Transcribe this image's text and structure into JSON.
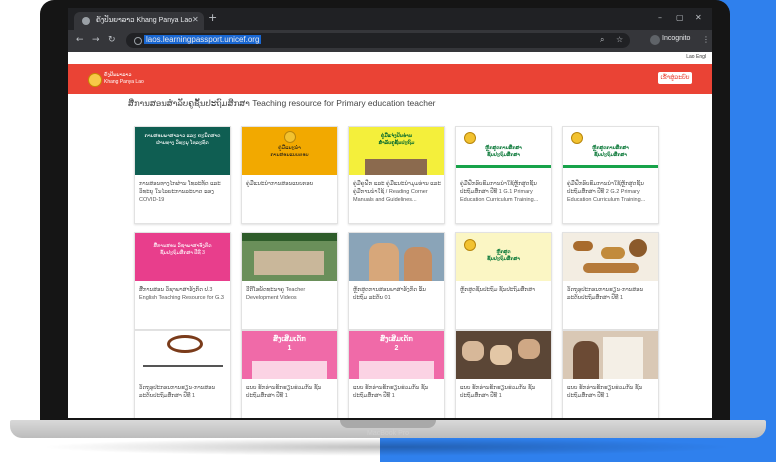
{
  "browser": {
    "tab_title": "ຄັງປັນຍາລາວ Khang Panya Lao",
    "new_tab": "+",
    "url": "laos.learningpassport.unicef.org",
    "profile": "Incognito",
    "win_min": "–",
    "win_max": "▢",
    "win_close": "✕",
    "back": "←",
    "forward": "→",
    "reload": "↻",
    "search_glyph": "⌕",
    "star_glyph": "☆",
    "menu_glyph": "⋮",
    "tab_close": "✕"
  },
  "site": {
    "lang_switch": "Lao  Engl",
    "logo_text": "ຄັງປັນຍາລາວ\nKhang Panya Lao",
    "login_label": "ເຂົ້າສູ່ລະບົບ",
    "page_title": "ສື່ການສອນສຳລັບຄູຊັ້ນປະຖົມສຶກສາ Teaching resource for Primary education teacher"
  },
  "cards": [
    {
      "thumb_text": "ການສອນພາສາລາວ ແລະ ຄະນິດສາດ\nຜ່ານທາງ ວິທະຍຸ ໂທລະທັດ",
      "caption": "ການສອນທາງໄກຜ່ານ ໂທລະທັດ ແລະ ວິທະຍຸ ໃນໄລຍະການລະບາດ ຂອງ COVID-19"
    },
    {
      "thumb_text": "ຄູ່ມືແນະນຳ\nການສອນແບບຕອບ",
      "caption": "ຄູ່ມືແນະນຳການສອນແບບຕອບ"
    },
    {
      "thumb_text": "ຄູ່ມືແຈ່ງປັນອ່ານ\nສຳລັບຄູຊັ້ນປະຖົມ",
      "caption": "ຄູ່ມືຄູຝຶກ ແລະ ຄູ່ມືແນະນຳມຸມອ່ານ ແລະ ຄູ່ມືການນຳໃຊ້ / Reading Corner Manuals and Guidelines..."
    },
    {
      "thumb_text": "ຫຼັກສູດການສຶກສາ\nຊັ້ນປະຖົມສຶກສາ",
      "caption": "ຄູ່ມືຝຶກອົບຮົມການນຳໃຊ້ຫຼັກສູດຊັ້ນ ປະຖົມສຶກສາ ປີທີ 1 G.1 Primary Education Curriculum Training..."
    },
    {
      "thumb_text": "ຫຼັກສູດການສຶກສາ\nຊັ້ນປະຖົມສຶກສາ",
      "caption": "ຄູ່ມືຝຶກອົບຮົມການນຳໃຊ້ຫຼັກສູດຊັ້ນ ປະຖົມສຶກສາ ປີທີ 2 G.2 Primary Education Curriculum Training..."
    },
    {
      "thumb_text": "ສື່ການສອນ ວິຊາພາສາອັງກິດ\nຊັ້ນປະຖົມສຶກສາ ປີທີ 3",
      "caption": "ສື່ການສອນ ວິຊາພາສາອັງກິດ ປ.3 English Teaching Resource for G.3"
    },
    {
      "thumb_text": "",
      "caption": "ວີດີໂອພັດທະນາຄູ Teacher Development Videos"
    },
    {
      "thumb_text": "",
      "caption": "ຫຼັກສູດການສອນພາສາອັງກິດ ຂັ້ນ ປະຖົມ ລະດັບ 01"
    },
    {
      "thumb_text": "ຫຼັກສູດ\nຊັ້ນປະຖົມສຶກສາ",
      "caption": "ຫຼັກສູດຊັ້ນປະຖົມ ຊັ້ນປະຖົມສຶກສາ"
    },
    {
      "thumb_text": "",
      "caption": "ວັດຖຸອຸປະກອນການຮຽນ-ການສອນ ລະດັບປະຖົມສຶກສາ ປີທີ 1"
    },
    {
      "thumb_text": "",
      "caption": "ວັດຖຸອຸປະກອນການຮຽນ-ການສອນ ລະດັບປະຖົມສຶກສາ ປີທີ 1"
    },
    {
      "thumb_text": "ສົ່ງເສີມເດັກ\n1",
      "caption": "ແບບ ຮັກອ່ານຮັກຮຽນຮ່ວມກັນ ຊັ້ນ ປະຖົມສຶກສາ ປີທີ 1"
    },
    {
      "thumb_text": "ສົ່ງເສີມເດັກ\n2",
      "caption": "ແບບ ຮັກອ່ານຮັກຮຽນຮ່ວມກັນ ຊັ້ນ ປະຖົມສຶກສາ ປີທີ 1"
    },
    {
      "thumb_text": "",
      "caption": "ແບບ ຮັກອ່ານຮັກຮຽນຮ່ວມກັນ ຊັ້ນ ປະຖົມສຶກສາ ປີທີ 1"
    },
    {
      "thumb_text": "",
      "caption": "ແບບ ຮັກອ່ານຮັກຮຽນຮ່ວມກັນ ຊັ້ນ ປະຖົມສຶກສາ ປີທີ 1"
    }
  ],
  "device": {
    "label": "MacBook Pro"
  },
  "colors": {
    "header": "#ea4335",
    "accent_blue": "#2f80ed"
  }
}
